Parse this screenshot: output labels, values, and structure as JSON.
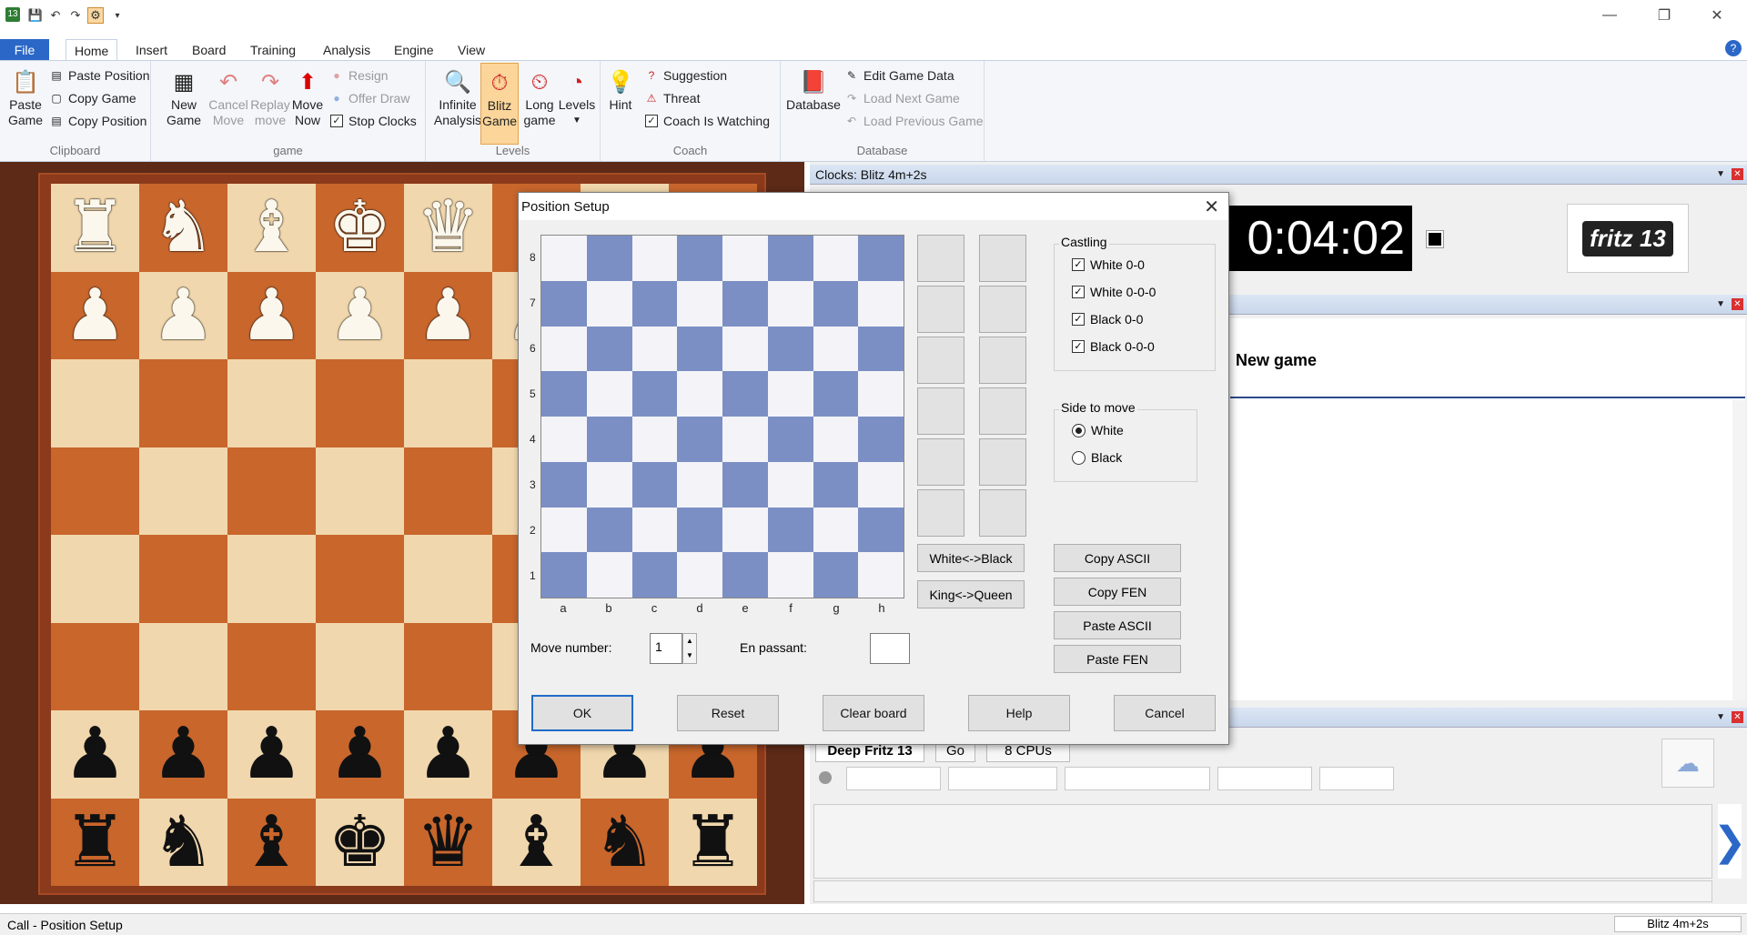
{
  "titlebar": {
    "app_badge": "13",
    "quick_access": [
      "save-icon",
      "undo-icon",
      "redo-icon",
      "blitz-icon",
      "customize-icon"
    ]
  },
  "tabs": {
    "file": "File",
    "items": [
      "Home",
      "Insert",
      "Board",
      "Training",
      "Analysis",
      "Engine",
      "View"
    ],
    "active": "Home",
    "help": "?"
  },
  "ribbon": {
    "clipboard": {
      "label": "Clipboard",
      "paste_game": "Paste Game",
      "paste_position": "Paste Position",
      "copy_game": "Copy Game",
      "copy_position": "Copy Position"
    },
    "game": {
      "label": "game",
      "new_game": "New Game",
      "cancel_move": "Cancel Move",
      "replay_move": "Replay move",
      "move_now": "Move Now",
      "resign": "Resign",
      "offer_draw": "Offer Draw",
      "stop_clocks": "Stop Clocks"
    },
    "levels": {
      "label": "Levels",
      "infinite_analysis": "Infinite Analysis",
      "blitz_game": "Blitz Game",
      "long_game": "Long game",
      "levels": "Levels"
    },
    "coach": {
      "label": "Coach",
      "hint": "Hint",
      "suggestion": "Suggestion",
      "threat": "Threat",
      "coach_watching": "Coach Is Watching"
    },
    "database": {
      "label": "Database",
      "database": "Database",
      "edit_game_data": "Edit Game Data",
      "load_next_game": "Load Next Game",
      "load_previous_game": "Load Previous Game"
    }
  },
  "board": {
    "rows": [
      [
        "♜",
        "♞",
        "♝",
        "♚",
        "♛",
        "♝",
        "♞",
        "♜"
      ],
      [
        "♟",
        "♟",
        "♟",
        "♟",
        "♟",
        "♟",
        "♟",
        "♟"
      ],
      [
        "",
        "",
        "",
        "",
        "",
        "",
        "",
        ""
      ],
      [
        "",
        "",
        "",
        "",
        "",
        "",
        "",
        ""
      ],
      [
        "",
        "",
        "",
        "",
        "",
        "",
        "",
        ""
      ],
      [
        "",
        "",
        "",
        "",
        "",
        "",
        "",
        ""
      ],
      [
        "♟",
        "♟",
        "♟",
        "♟",
        "♟",
        "♟",
        "♟",
        "♟"
      ],
      [
        "♜",
        "♞",
        "♝",
        "♚",
        "♛",
        "♝",
        "♞",
        "♜"
      ]
    ],
    "colors": [
      [
        "w",
        "w",
        "w",
        "w",
        "w",
        "w",
        "w",
        "w"
      ],
      [
        "w",
        "w",
        "w",
        "w",
        "w",
        "w",
        "w",
        "w"
      ],
      [
        "",
        "",
        "",
        "",
        "",
        "",
        "",
        ""
      ],
      [
        "",
        "",
        "",
        "",
        "",
        "",
        "",
        ""
      ],
      [
        "",
        "",
        "",
        "",
        "",
        "",
        "",
        ""
      ],
      [
        "",
        "",
        "",
        "",
        "",
        "",
        "",
        ""
      ],
      [
        "b",
        "b",
        "b",
        "b",
        "b",
        "b",
        "b",
        "b"
      ],
      [
        "b",
        "b",
        "b",
        "b",
        "b",
        "b",
        "b",
        "b"
      ]
    ]
  },
  "clocks": {
    "header": "Clocks: Blitz 4m+2s",
    "time": "0:04:02",
    "logo": "fritz 13"
  },
  "notation": {
    "title": "New game"
  },
  "engine": {
    "name": "Deep Fritz 13",
    "go": "Go",
    "cpus": "8 CPUs"
  },
  "dialog": {
    "title": "Position Setup",
    "ranks": [
      "8",
      "7",
      "6",
      "5",
      "4",
      "3",
      "2",
      "1"
    ],
    "files": [
      "a",
      "b",
      "c",
      "d",
      "e",
      "f",
      "g",
      "h"
    ],
    "castling": {
      "legend": "Castling",
      "white_oo": "White 0-0",
      "white_ooo": "White 0-0-0",
      "black_oo": "Black 0-0",
      "black_ooo": "Black 0-0-0"
    },
    "side_to_move": {
      "legend": "Side to move",
      "white": "White",
      "black": "Black",
      "selected": "White"
    },
    "buttons": {
      "white_black": "White<->Black",
      "king_queen": "King<->Queen",
      "copy_ascii": "Copy ASCII",
      "copy_fen": "Copy FEN",
      "paste_ascii": "Paste ASCII",
      "paste_fen": "Paste FEN",
      "ok": "OK",
      "reset": "Reset",
      "clear_board": "Clear board",
      "help": "Help",
      "cancel": "Cancel"
    },
    "move_number_label": "Move number:",
    "move_number": "1",
    "en_passant_label": "En passant:",
    "en_passant": ""
  },
  "status": {
    "left": "Call - Position Setup",
    "right": "Blitz 4m+2s"
  },
  "colors": {
    "accent": "#2b67c7",
    "light_square": "#f1d7ad",
    "dark_square": "#c8662c",
    "setup_dark": "#7b8fc4"
  }
}
